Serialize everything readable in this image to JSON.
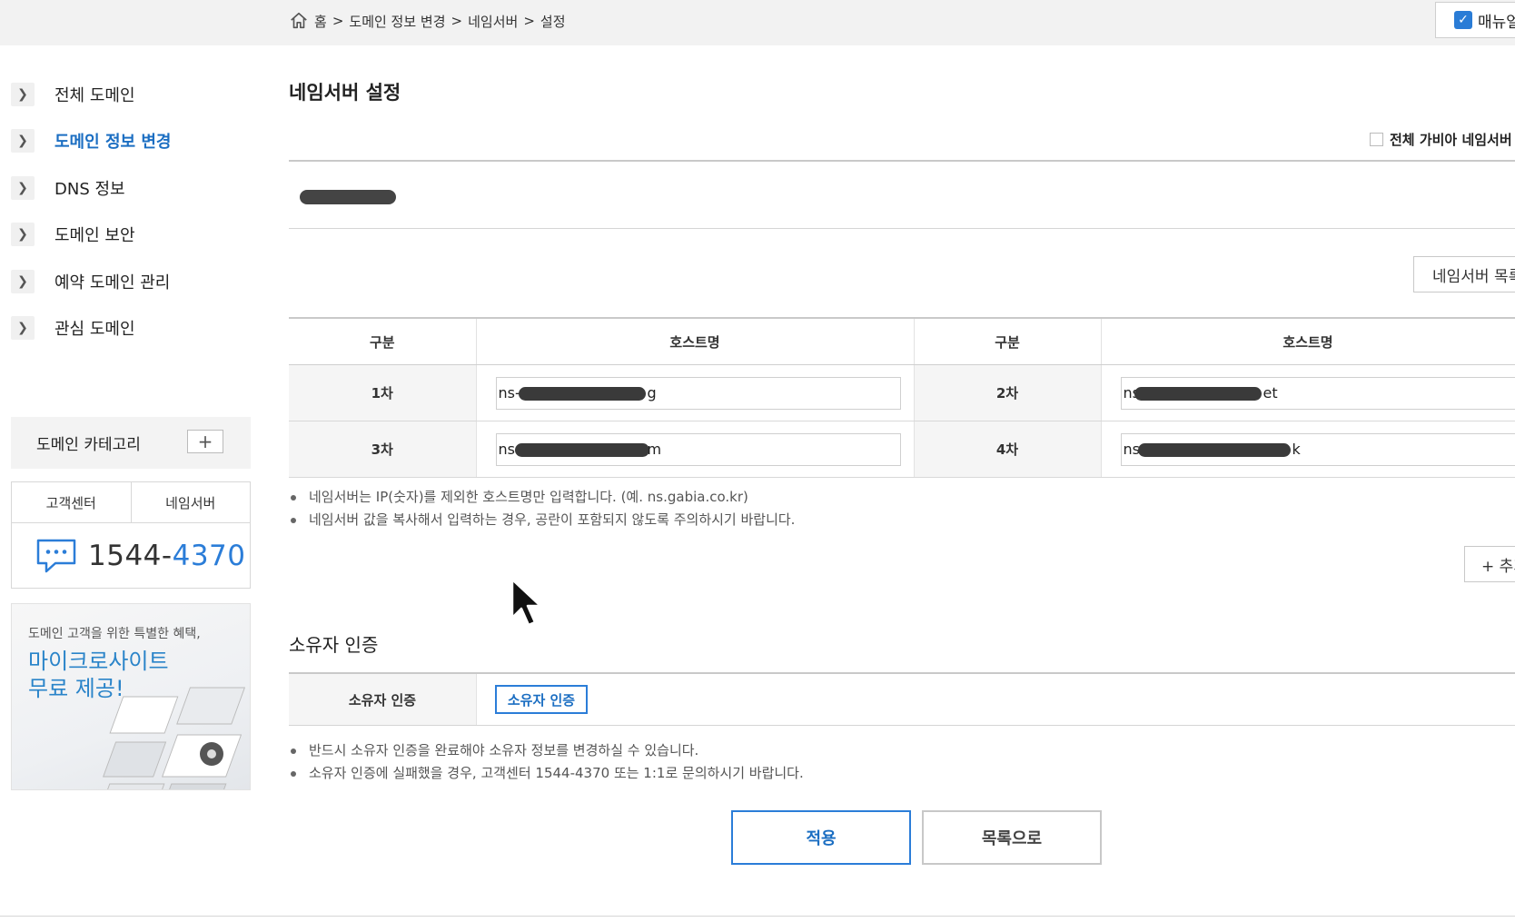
{
  "breadcrumb": {
    "home": "홈",
    "items": [
      "도메인 정보 변경",
      "네임서버",
      "설정"
    ],
    "separator": ">"
  },
  "manual_button": {
    "label": "매뉴얼"
  },
  "sidebar": {
    "items": [
      {
        "label": "전체 도메인",
        "active": false
      },
      {
        "label": "도메인 정보 변경",
        "active": true
      },
      {
        "label": "DNS 정보",
        "active": false
      },
      {
        "label": "도메인 보안",
        "active": false
      },
      {
        "label": "예약 도메인 관리",
        "active": false
      },
      {
        "label": "관심 도메인",
        "active": false
      }
    ],
    "category": {
      "label": "도메인 카테고리",
      "add": "+"
    },
    "customer_center": {
      "tabs": [
        "고객센터",
        "네임서버"
      ],
      "phone_prefix": "1544-",
      "phone_suffix": "4370"
    },
    "promo": {
      "sub": "도메인 고객을 위한 특별한 혜택,",
      "headline": "마이크로사이트\n무료 제공!"
    }
  },
  "main": {
    "title": "네임서버 설정",
    "all_gabia_label": "전체 가비아 네임서버",
    "ns_list_button": "네임서버 목록",
    "table": {
      "headers": [
        "구분",
        "호스트명",
        "구분",
        "호스트명"
      ],
      "rows": [
        [
          {
            "label": "1차",
            "prefix": "ns-",
            "suffix": "g"
          },
          {
            "label": "2차",
            "prefix": "ns",
            "suffix": "et"
          }
        ],
        [
          {
            "label": "3차",
            "prefix": "ns",
            "suffix": "m"
          },
          {
            "label": "4차",
            "prefix": "ns",
            "suffix": "k"
          }
        ]
      ]
    },
    "notes": [
      "네임서버는 IP(숫자)를 제외한 호스트명만 입력합니다. (예. ns.gabia.co.kr)",
      "네임서버 값을 복사해서 입력하는 경우, 공란이 포함되지 않도록 주의하시기 바랍니다."
    ],
    "add_button": "+ 추가",
    "owner": {
      "title": "소유자 인증",
      "row_label": "소유자 인증",
      "button": "소유자 인증",
      "notes": [
        "반드시 소유자 인증을 완료해야 소유자 정보를 변경하실 수 있습니다.",
        "소유자 인증에 실패했을 경우, 고객센터 1544-4370 또는 1:1로 문의하시기 바랍니다."
      ]
    },
    "apply_button": "적용",
    "list_button": "목록으로"
  },
  "colors": {
    "accent": "#2b7dd8",
    "active_text": "#1b6ec2",
    "topbar": "#f2f2f2"
  }
}
